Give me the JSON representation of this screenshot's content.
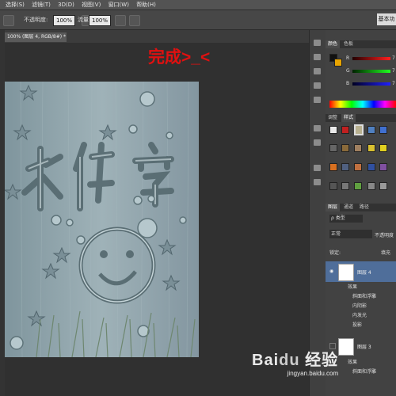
{
  "menu": [
    "选择(S)",
    "滤镜(T)",
    "3D(D)",
    "视图(V)",
    "窗口(W)",
    "帮助(H)"
  ],
  "options": {
    "mode_label": "不透明度:",
    "opacity_value": "100%",
    "flow_label": "流量:",
    "flow_value": "100%",
    "workspace_label": "基本功"
  },
  "document_tab": "100% (图层 4, RGB/8#) *",
  "overlay_caption": "完成>_<",
  "artwork": {
    "title_chars": "水体字"
  },
  "color_panel": {
    "tabs": [
      "颜色",
      "色板"
    ],
    "channels": [
      {
        "label": "R",
        "value": "7"
      },
      {
        "label": "G",
        "value": "7"
      },
      {
        "label": "B",
        "value": "7"
      }
    ]
  },
  "styles_panel": {
    "tabs": [
      "调整",
      "样式"
    ]
  },
  "layers_panel": {
    "tabs": [
      "图层",
      "通道",
      "路径"
    ],
    "kind_label": "ρ 类型",
    "blend_mode": "正常",
    "opacity_label": "不透明度",
    "lock_label": "锁定:",
    "fill_label": "填充",
    "layers": [
      {
        "name": "图层 4",
        "effects_label": "效果",
        "effects": [
          "斜面和浮雕",
          "内阴影",
          "内发光",
          "投影"
        ]
      },
      {
        "name": "图层 3",
        "effects_label": "效果",
        "effects": [
          "斜面和浮雕"
        ]
      }
    ]
  },
  "watermark": {
    "site": "jingyan.baidu.com"
  },
  "colors": {
    "accent_red": "#e01010",
    "artwork_bg": "#8a9ea5",
    "foreground_swatch": "#111111",
    "background_swatch": "#e8a400"
  }
}
